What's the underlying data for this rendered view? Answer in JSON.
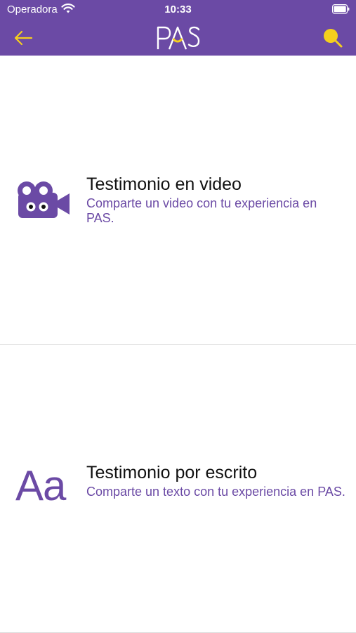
{
  "status_bar": {
    "carrier": "Operadora",
    "time": "10:33"
  },
  "nav": {
    "logo_text": "PAS",
    "back_icon": "arrow-left-icon",
    "search_icon": "search-icon"
  },
  "options": [
    {
      "title": "Testimonio en video",
      "description": "Comparte un video con tu experiencia en PAS.",
      "icon": "video-camera-icon"
    },
    {
      "title": "Testimonio por escrito",
      "description": "Comparte un texto con tu experiencia en PAS.",
      "icon": "text-icon",
      "icon_text": "Aa"
    }
  ],
  "colors": {
    "brand_purple": "#6b4aa5",
    "accent_yellow": "#f5cf1d",
    "title_text": "#111111",
    "divider": "#dcdcdc"
  }
}
